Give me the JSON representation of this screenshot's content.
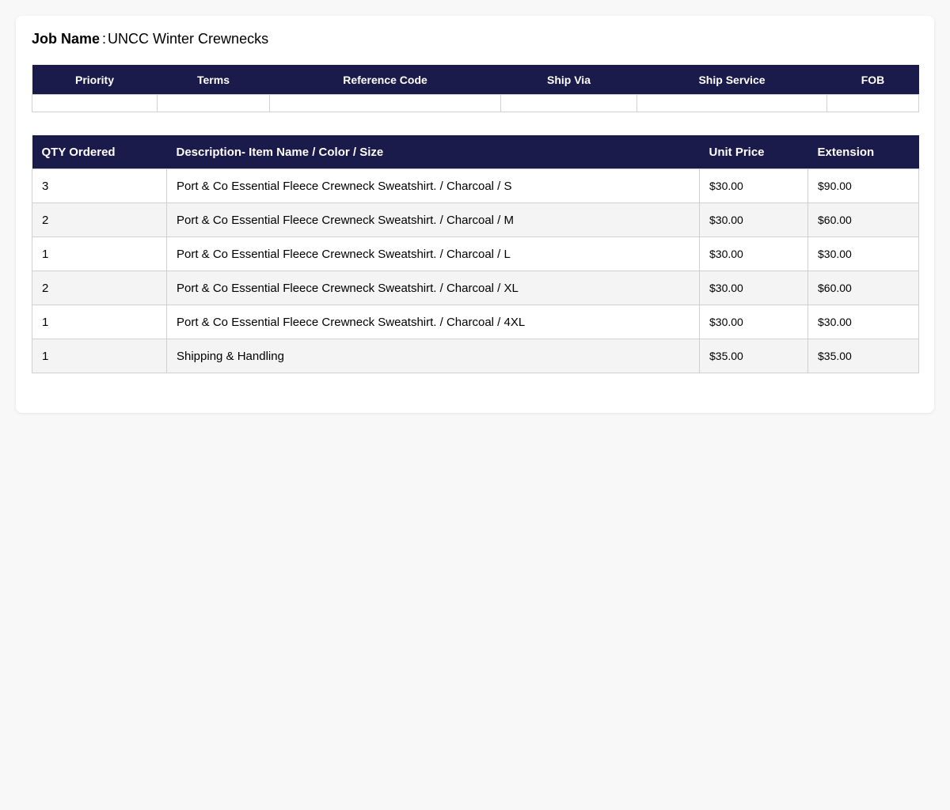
{
  "job": {
    "label": "Job Name",
    "separator": ":",
    "value": "UNCC Winter Crewnecks"
  },
  "info_table": {
    "headers": [
      "Priority",
      "Terms",
      "Reference Code",
      "Ship Via",
      "Ship Service",
      "FOB"
    ],
    "values": [
      "",
      "",
      "",
      "",
      "",
      ""
    ]
  },
  "items_table": {
    "headers": [
      "QTY Ordered",
      "Description- Item Name / Color / Size",
      "Unit Price",
      "Extension"
    ],
    "rows": [
      {
        "qty": "3",
        "description": "Port & Co Essential Fleece Crewneck Sweatshirt. / Charcoal / S",
        "unit_price": "$30.00",
        "extension": "$90.00"
      },
      {
        "qty": "2",
        "description": "Port & Co Essential Fleece Crewneck Sweatshirt. / Charcoal / M",
        "unit_price": "$30.00",
        "extension": "$60.00"
      },
      {
        "qty": "1",
        "description": "Port & Co Essential Fleece Crewneck Sweatshirt. / Charcoal / L",
        "unit_price": "$30.00",
        "extension": "$30.00"
      },
      {
        "qty": "2",
        "description": "Port & Co Essential Fleece Crewneck Sweatshirt. / Charcoal / XL",
        "unit_price": "$30.00",
        "extension": "$60.00"
      },
      {
        "qty": "1",
        "description": "Port & Co Essential Fleece Crewneck Sweatshirt. / Charcoal / 4XL",
        "unit_price": "$30.00",
        "extension": "$30.00"
      },
      {
        "qty": "1",
        "description": "Shipping & Handling",
        "unit_price": "$35.00",
        "extension": "$35.00"
      }
    ]
  },
  "colors": {
    "header_bg": "#1b1b4b",
    "header_text": "#ffffff",
    "row_alt_bg": "#f4f4f4",
    "page_bg": "#f8f8f8"
  }
}
